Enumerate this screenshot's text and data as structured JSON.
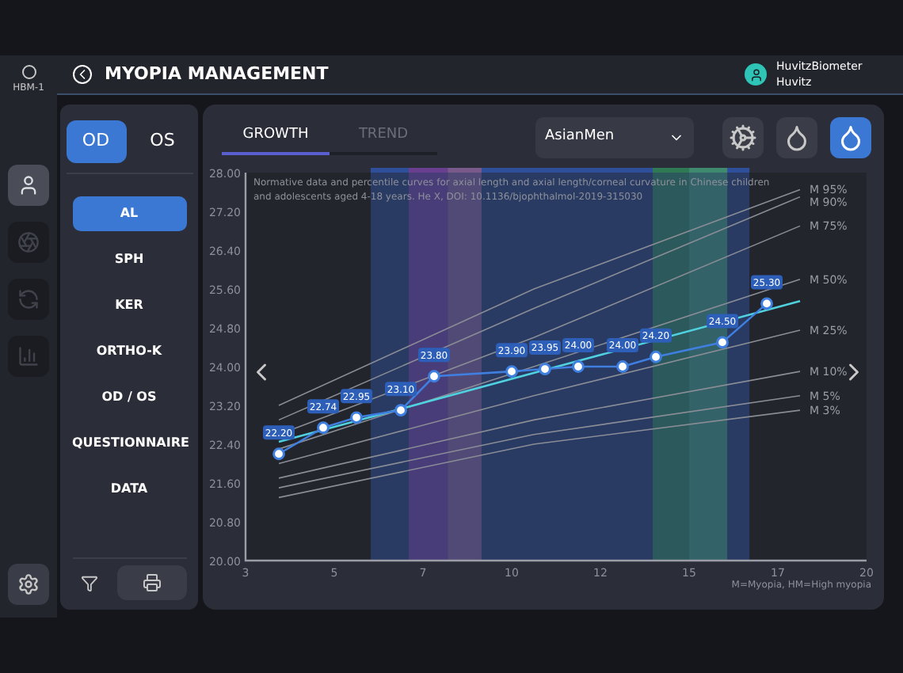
{
  "rail": {
    "device_label": "HBM-1",
    "items": [
      {
        "selected": true
      },
      {
        "selected": false
      },
      {
        "selected": false
      },
      {
        "selected": false
      }
    ]
  },
  "header": {
    "title": "MYOPIA MANAGEMENT",
    "user_name": "HuvitzBiometer",
    "user_org": "Huvitz"
  },
  "eye_tabs": [
    {
      "label": "OD",
      "selected": true
    },
    {
      "label": "OS",
      "selected": false
    }
  ],
  "menu": [
    {
      "label": "AL",
      "selected": true
    },
    {
      "label": "SPH",
      "selected": false
    },
    {
      "label": "KER",
      "selected": false
    },
    {
      "label": "ORTHO-K",
      "selected": false
    },
    {
      "label": "OD / OS",
      "selected": false
    },
    {
      "label": "QUESTIONNAIRE",
      "selected": false
    },
    {
      "label": "DATA",
      "selected": false
    }
  ],
  "view_tabs": [
    {
      "label": "GROWTH",
      "selected": true
    },
    {
      "label": "TREND",
      "selected": false
    }
  ],
  "population": {
    "value": "AsianMen"
  },
  "tool_buttons": [
    {
      "selected": false
    },
    {
      "selected": false
    },
    {
      "selected": true
    }
  ],
  "chart": {
    "note": "Normative data and percentile curves for axial length and axial length/corneal curvature in Chinese children and adolescents aged 4-18 years. He X, DOI: 10.1136/bjophthalmol-2019-315030",
    "footer": "M=Myopia, HM=High myopia",
    "chart_data": {
      "type": "line",
      "ylim": [
        20,
        28
      ],
      "categories": [
        "3",
        null,
        null,
        null,
        null,
        null,
        null,
        null,
        "5",
        null,
        null,
        null,
        null,
        null,
        null,
        null,
        "7",
        null,
        null,
        null,
        null,
        null,
        null,
        null,
        "10",
        null,
        null,
        null,
        null,
        null,
        null,
        null,
        "12",
        null,
        null,
        null,
        null,
        null,
        null,
        null,
        "15",
        null,
        null,
        null,
        null,
        null,
        null,
        null,
        "17",
        null,
        null,
        null,
        null,
        null,
        null,
        null,
        "20"
      ],
      "yticks": [
        {
          "value": 20,
          "label": "20.00"
        },
        {
          "value": 20.8,
          "label": "20.80"
        },
        {
          "value": 21.6,
          "label": "21.60"
        },
        {
          "value": 22.4,
          "label": "22.40"
        },
        {
          "value": 23.2,
          "label": "23.20"
        },
        {
          "value": 24,
          "label": "24.00"
        },
        {
          "value": 24.8,
          "label": "24.80"
        },
        {
          "value": 25.6,
          "label": "25.60"
        },
        {
          "value": 26.4,
          "label": "26.40"
        },
        {
          "value": 27.2,
          "label": "27.20"
        },
        {
          "value": 28,
          "label": "28.00"
        }
      ],
      "series": [
        {
          "name": "M 95%",
          "color": "#8a8d96",
          "values": [
            null,
            null,
            null,
            23.2,
            null,
            null,
            null,
            null,
            null,
            null,
            null,
            null,
            null,
            null,
            null,
            null,
            null,
            null,
            null,
            null,
            null,
            null,
            null,
            null,
            null,
            null,
            25.6,
            null,
            null,
            null,
            null,
            null,
            null,
            null,
            null,
            null,
            null,
            null,
            null,
            null,
            null,
            null,
            null,
            null,
            null,
            null,
            null,
            null,
            null,
            null,
            27.65,
            null,
            null,
            null,
            null,
            null,
            null
          ]
        },
        {
          "name": "M 90%",
          "color": "#8a8d96",
          "values": [
            null,
            null,
            null,
            22.9,
            null,
            null,
            null,
            null,
            null,
            null,
            null,
            null,
            null,
            null,
            null,
            null,
            null,
            null,
            null,
            null,
            null,
            null,
            null,
            null,
            null,
            null,
            25.2,
            null,
            null,
            null,
            null,
            null,
            null,
            null,
            null,
            null,
            null,
            null,
            null,
            null,
            null,
            null,
            null,
            null,
            null,
            null,
            null,
            null,
            null,
            null,
            27.5,
            null,
            null,
            null,
            null,
            null,
            null
          ]
        },
        {
          "name": "M 75%",
          "color": "#8a8d96",
          "values": [
            null,
            null,
            null,
            22.6,
            null,
            null,
            null,
            null,
            null,
            null,
            null,
            null,
            null,
            null,
            null,
            null,
            null,
            null,
            null,
            null,
            null,
            null,
            null,
            null,
            null,
            null,
            24.6,
            null,
            null,
            null,
            null,
            null,
            null,
            null,
            null,
            null,
            null,
            null,
            null,
            null,
            null,
            null,
            null,
            null,
            null,
            null,
            null,
            null,
            null,
            null,
            26.9,
            null,
            null,
            null,
            null,
            null,
            null
          ]
        },
        {
          "name": "M 50%",
          "color": "#8a8d96",
          "values": [
            null,
            null,
            null,
            22.3,
            null,
            null,
            null,
            null,
            null,
            null,
            null,
            null,
            null,
            null,
            null,
            null,
            null,
            null,
            null,
            null,
            null,
            null,
            null,
            null,
            null,
            null,
            24.0,
            null,
            null,
            null,
            null,
            null,
            null,
            null,
            null,
            null,
            null,
            null,
            null,
            null,
            null,
            null,
            null,
            null,
            null,
            null,
            null,
            null,
            null,
            null,
            25.8,
            null,
            null,
            null,
            null,
            null,
            null
          ]
        },
        {
          "name": "M 25%",
          "color": "#8a8d96",
          "values": [
            null,
            null,
            null,
            22.0,
            null,
            null,
            null,
            null,
            null,
            null,
            null,
            null,
            null,
            null,
            null,
            null,
            null,
            null,
            null,
            null,
            null,
            null,
            null,
            null,
            null,
            null,
            23.4,
            null,
            null,
            null,
            null,
            null,
            null,
            null,
            null,
            null,
            null,
            null,
            null,
            null,
            null,
            null,
            null,
            null,
            null,
            null,
            null,
            null,
            null,
            null,
            24.75,
            null,
            null,
            null,
            null,
            null,
            null
          ]
        },
        {
          "name": "M 10%",
          "color": "#8a8d96",
          "values": [
            null,
            null,
            null,
            21.7,
            null,
            null,
            null,
            null,
            null,
            null,
            null,
            null,
            null,
            null,
            null,
            null,
            null,
            null,
            null,
            null,
            null,
            null,
            null,
            null,
            null,
            null,
            22.9,
            null,
            null,
            null,
            null,
            null,
            null,
            null,
            null,
            null,
            null,
            null,
            null,
            null,
            null,
            null,
            null,
            null,
            null,
            null,
            null,
            null,
            null,
            null,
            23.9,
            null,
            null,
            null,
            null,
            null,
            null
          ]
        },
        {
          "name": "M 5%",
          "color": "#8a8d96",
          "values": [
            null,
            null,
            null,
            21.5,
            null,
            null,
            null,
            null,
            null,
            null,
            null,
            null,
            null,
            null,
            null,
            null,
            null,
            null,
            null,
            null,
            null,
            null,
            null,
            null,
            null,
            null,
            22.6,
            null,
            null,
            null,
            null,
            null,
            null,
            null,
            null,
            null,
            null,
            null,
            null,
            null,
            null,
            null,
            null,
            null,
            null,
            null,
            null,
            null,
            null,
            null,
            23.4,
            null,
            null,
            null,
            null,
            null,
            null
          ]
        },
        {
          "name": "M 3%",
          "color": "#8a8d96",
          "values": [
            null,
            null,
            null,
            21.3,
            null,
            null,
            null,
            null,
            null,
            null,
            null,
            null,
            null,
            null,
            null,
            null,
            null,
            null,
            null,
            null,
            null,
            null,
            null,
            null,
            null,
            null,
            22.4,
            null,
            null,
            null,
            null,
            null,
            null,
            null,
            null,
            null,
            null,
            null,
            null,
            null,
            null,
            null,
            null,
            null,
            null,
            null,
            null,
            null,
            null,
            null,
            23.1,
            null,
            null,
            null,
            null,
            null,
            null
          ]
        },
        {
          "color": "#4fd1e0",
          "values": [
            null,
            null,
            null,
            22.45,
            null,
            null,
            null,
            null,
            null,
            null,
            null,
            null,
            null,
            null,
            null,
            null,
            null,
            null,
            null,
            null,
            null,
            null,
            null,
            null,
            null,
            null,
            null,
            null,
            null,
            null,
            null,
            null,
            null,
            null,
            null,
            null,
            null,
            null,
            null,
            null,
            null,
            null,
            null,
            null,
            null,
            null,
            null,
            null,
            null,
            null,
            25.35,
            null,
            null,
            null,
            null,
            null,
            null
          ]
        },
        {
          "color": "#3f7fe0",
          "marker": "circle",
          "values": [
            null,
            null,
            null,
            22.2,
            null,
            null,
            null,
            22.74,
            null,
            null,
            22.95,
            null,
            null,
            null,
            23.1,
            null,
            null,
            23.8,
            null,
            null,
            null,
            null,
            null,
            null,
            23.9,
            null,
            null,
            23.95,
            null,
            null,
            24.0,
            null,
            null,
            null,
            24.0,
            null,
            null,
            24.2,
            null,
            null,
            null,
            null,
            null,
            24.5,
            null,
            null,
            null,
            25.3,
            null,
            null,
            null,
            null,
            null,
            null,
            null,
            null,
            null
          ],
          "value_labels": [
            null,
            null,
            null,
            "22.20",
            null,
            null,
            null,
            "22.74",
            null,
            null,
            "22.95",
            null,
            null,
            null,
            "23.10",
            null,
            null,
            "23.80",
            null,
            null,
            null,
            null,
            null,
            null,
            "23.90",
            null,
            null,
            "23.95",
            null,
            null,
            "24.00",
            null,
            null,
            null,
            "24.00",
            null,
            null,
            "24.20",
            null,
            null,
            null,
            null,
            null,
            "24.50",
            null,
            null,
            null,
            "25.30",
            null,
            null,
            null,
            null,
            null,
            null,
            null,
            null,
            null
          ]
        }
      ]
    }
  }
}
